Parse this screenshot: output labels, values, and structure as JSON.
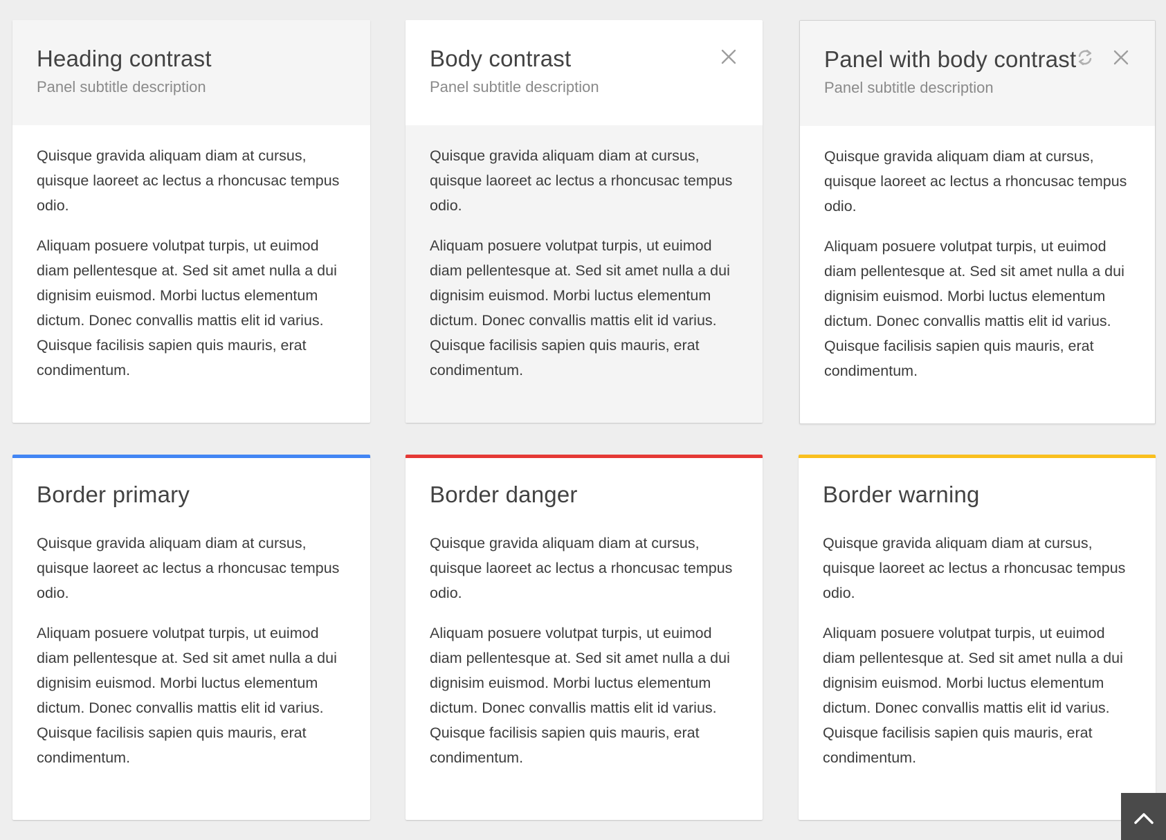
{
  "colors": {
    "primary": "#4285f4",
    "danger": "#e53935",
    "warning": "#f9bf1e",
    "heading_shade": "#f5f5f5",
    "body_shade": "#f4f4f4"
  },
  "panels": [
    {
      "title": "Heading contrast",
      "subtitle": "Panel subtitle description",
      "paragraphs": [
        "Quisque gravida aliquam diam at cursus, quisque laoreet ac lectus a rhoncusac tempus odio.",
        "Aliquam posuere volutpat turpis, ut euimod diam pellentesque at. Sed sit amet nulla a dui dignisim euismod. Morbi luctus elementum dictum. Donec convallis mattis elit id varius. Quisque facilisis sapien quis mauris, erat condimentum."
      ]
    },
    {
      "title": "Body contrast",
      "subtitle": "Panel subtitle description",
      "paragraphs": [
        "Quisque gravida aliquam diam at cursus, quisque laoreet ac lectus a rhoncusac tempus odio.",
        "Aliquam posuere volutpat turpis, ut euimod diam pellentesque at. Sed sit amet nulla a dui dignisim euismod. Morbi luctus elementum dictum. Donec convallis mattis elit id varius. Quisque facilisis sapien quis mauris, erat condimentum."
      ],
      "actions": [
        "close-icon"
      ]
    },
    {
      "title": "Panel with body contrast",
      "subtitle": "Panel subtitle description",
      "paragraphs": [
        "Quisque gravida aliquam diam at cursus, quisque laoreet ac lectus a rhoncusac tempus odio.",
        "Aliquam posuere volutpat turpis, ut euimod diam pellentesque at. Sed sit amet nulla a dui dignisim euismod. Morbi luctus elementum dictum. Donec convallis mattis elit id varius. Quisque facilisis sapien quis mauris, erat condimentum."
      ],
      "actions": [
        "refresh-icon",
        "close-icon"
      ]
    },
    {
      "title": "Border primary",
      "paragraphs": [
        "Quisque gravida aliquam diam at cursus, quisque laoreet ac lectus a rhoncusac tempus odio.",
        "Aliquam posuere volutpat turpis, ut euimod diam pellentesque at. Sed sit amet nulla a dui dignisim euismod. Morbi luctus elementum dictum. Donec convallis mattis elit id varius. Quisque facilisis sapien quis mauris, erat condimentum."
      ]
    },
    {
      "title": "Border danger",
      "paragraphs": [
        "Quisque gravida aliquam diam at cursus, quisque laoreet ac lectus a rhoncusac tempus odio.",
        "Aliquam posuere volutpat turpis, ut euimod diam pellentesque at. Sed sit amet nulla a dui dignisim euismod. Morbi luctus elementum dictum. Donec convallis mattis elit id varius. Quisque facilisis sapien quis mauris, erat condimentum."
      ]
    },
    {
      "title": "Border warning",
      "paragraphs": [
        "Quisque gravida aliquam diam at cursus, quisque laoreet ac lectus a rhoncusac tempus odio.",
        "Aliquam posuere volutpat turpis, ut euimod diam pellentesque at. Sed sit amet nulla a dui dignisim euismod. Morbi luctus elementum dictum. Donec convallis mattis elit id varius. Quisque facilisis sapien quis mauris, erat condimentum."
      ]
    }
  ],
  "back_to_top": {
    "icon": "chevron-up-icon"
  }
}
